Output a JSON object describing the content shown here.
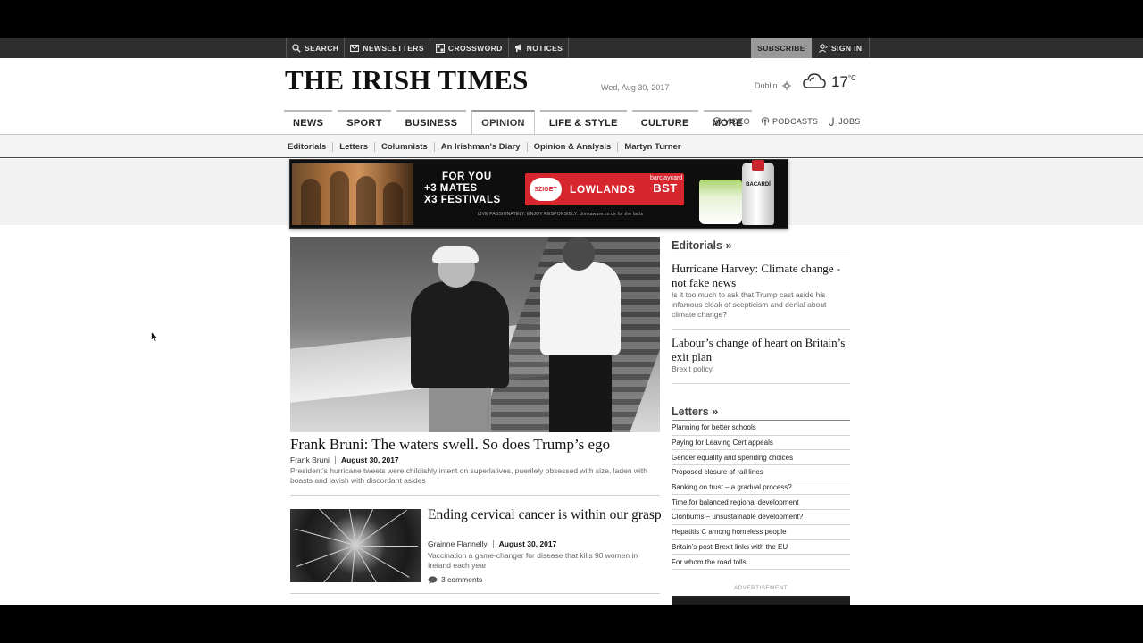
{
  "utility_bar": {
    "search": "SEARCH",
    "newsletters": "NEWSLETTERS",
    "crossword": "CROSSWORD",
    "notices": "NOTICES",
    "subscribe": "SUBSCRIBE",
    "sign_in": "SIGN IN"
  },
  "masthead": {
    "title": "THE IRISH TIMES",
    "date": "Wed, Aug 30, 2017",
    "weather_city": "Dublin",
    "temperature": "17",
    "temperature_unit": "°C",
    "weather_icon": "cloudy-icon"
  },
  "nav": {
    "items": [
      {
        "label": "NEWS",
        "active": false
      },
      {
        "label": "SPORT",
        "active": false
      },
      {
        "label": "BUSINESS",
        "active": false
      },
      {
        "label": "OPINION",
        "active": true
      },
      {
        "label": "LIFE & STYLE",
        "active": false
      },
      {
        "label": "CULTURE",
        "active": false
      },
      {
        "label": "MORE",
        "active": false
      }
    ],
    "video": "VIDEO",
    "podcasts": "PODCASTS",
    "jobs": "JOBS"
  },
  "subnav": {
    "items": [
      "Editorials",
      "Letters",
      "Columnists",
      "An Irishman's Diary",
      "Opinion & Analysis",
      "Martyn Turner"
    ]
  },
  "ad_banner": {
    "line1": "FOR YOU",
    "line2": "+3 MATES",
    "line3": "X3 FESTIVALS",
    "festival1": "SZIGET",
    "festival2": "LOWLANDS",
    "festival3_pre": "barclaycard",
    "festival3": "BST",
    "fine_print": "LIVE PASSIONATELY. ENJOY RESPONSIBLY. drinkaware.co.uk for the facts",
    "brand": "BACARDÍ"
  },
  "main_story": {
    "title": "Frank Bruni: The waters swell. So does Trump’s ego",
    "author": "Frank Bruni",
    "date": "August 30, 2017",
    "standfirst": "President’s hurricane tweets were childishly intent on superlatives, puerilely obsessed with size, laden with boasts and lavish with discordant asides"
  },
  "second_story": {
    "title": "Ending cervical cancer is within our grasp",
    "author": "Grainne Flannelly",
    "date": "August 30, 2017",
    "standfirst": "Vaccination a game-changer for disease that kills 90 women in Ireland each year",
    "comments": "3 comments"
  },
  "sidebar": {
    "editorials_heading": "Editorials",
    "editorials": [
      {
        "title": "Hurricane Harvey: Climate change - not fake news",
        "desc": "Is it too much to ask that Trump cast aside his infamous cloak of scepticism and denial about climate change?"
      },
      {
        "title": "Labour’s change of heart on Britain’s exit plan",
        "desc": "Brexit policy"
      }
    ],
    "letters_heading": "Letters",
    "letters": [
      "Planning for better schools",
      "Paying for Leaving Cert appeals",
      "Gender equality and spending choices",
      "Proposed closure of rail lines",
      "Banking on trust – a gradual process?",
      "Time for balanced regional development",
      "Clonburris – unsustainable development?",
      "Hepatitis C among homeless people",
      "Britain’s post-Brexit links with the EU",
      "For whom the road tolls"
    ],
    "advertisement_label": "ADVERTISEMENT"
  }
}
